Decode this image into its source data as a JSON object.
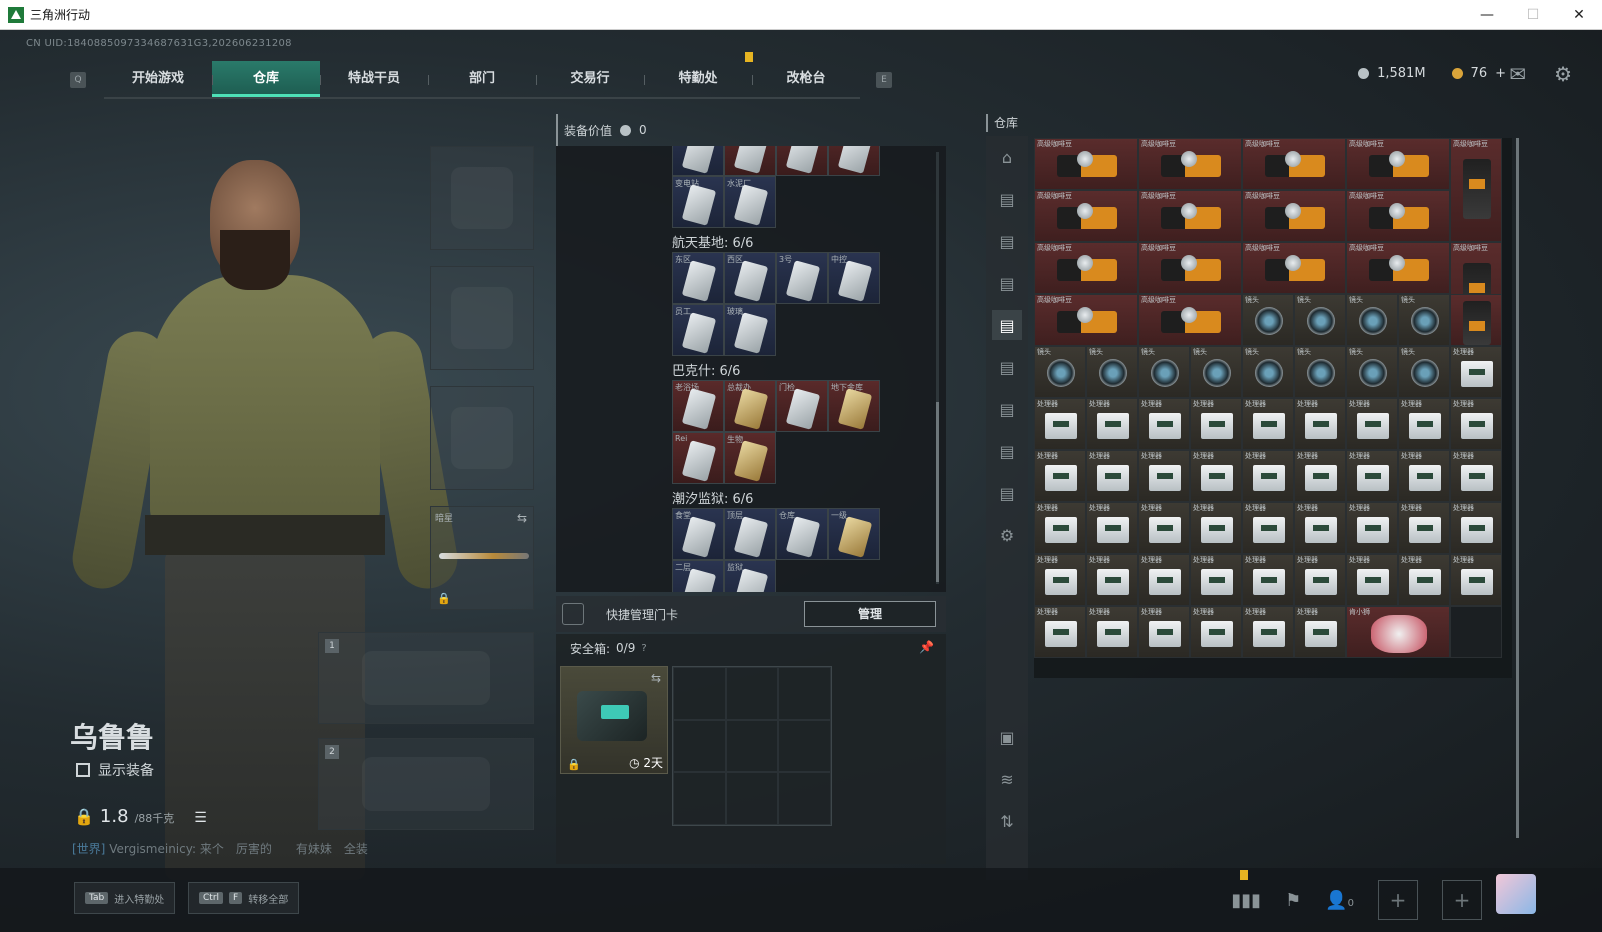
{
  "window": {
    "title": "三角洲行动",
    "controls": [
      "—",
      "☐",
      "✕"
    ]
  },
  "uid": "CN UID:1840885097334687631G3,202606231208",
  "nav": {
    "left_key": "Q",
    "right_key": "E",
    "tabs": [
      "开始游戏",
      "仓库",
      "特战干员",
      "部门",
      "交易行",
      "特勤处",
      "改枪台"
    ],
    "active": "仓库"
  },
  "currency": {
    "silver": "1,581M",
    "gold": "76",
    "plus": "+"
  },
  "icons": {
    "mail": "mail-icon",
    "settings": "gear-icon"
  },
  "character": {
    "name": "乌鲁鲁",
    "show_gear_label": "显示装备",
    "weight_value": "1.8",
    "weight_max": "/88千克"
  },
  "chat": {
    "channel": "[世界]",
    "user": "Vergismeinicy:",
    "text": "来个　厉害的　　有妹妹　全装"
  },
  "bottom": {
    "btn1_key": "Tab",
    "btn1_label": "进入特勤处",
    "btn2_key1": "Ctrl",
    "btn2_key2": "F",
    "btn2_label": "转移全部",
    "friends_count": "0",
    "plus1": "+",
    "plus2": "+"
  },
  "equipment": {
    "melee_label": "暗星",
    "slot1": "1",
    "slot2": "2"
  },
  "cards_panel": {
    "header": "装备价值",
    "value": "0",
    "groups": [
      {
        "title": "航天基地: 6/6"
      },
      {
        "title": "巴克什: 6/6"
      },
      {
        "title": "潮汐监狱: 6/6"
      }
    ],
    "tags": {
      "top_row2": [
        "变电站",
        "水泥厂"
      ],
      "space1": [
        "东区",
        "西区",
        "3号",
        "中控"
      ],
      "space2": [
        "员工",
        "玻璃"
      ],
      "bakesh1": [
        "老浴场",
        "总裁办",
        "门检",
        "地下金库"
      ],
      "bakesh2": [
        "Rei",
        "生物"
      ],
      "prison1": [
        "食堂",
        "顶层",
        "仓库",
        "一级"
      ],
      "prison2": [
        "二层",
        "监狱"
      ]
    }
  },
  "quick_manage": {
    "label": "快捷管理门卡",
    "button": "管理"
  },
  "safebox": {
    "label": "安全箱:",
    "count": "0/9",
    "help": "?",
    "pin": "📌",
    "time": "2天"
  },
  "warehouse": {
    "label": "仓库",
    "tags": {
      "coffee": "高级咖啡豆",
      "lens": "镜头",
      "cpu": "处理器",
      "figure": "肯小狮"
    }
  }
}
